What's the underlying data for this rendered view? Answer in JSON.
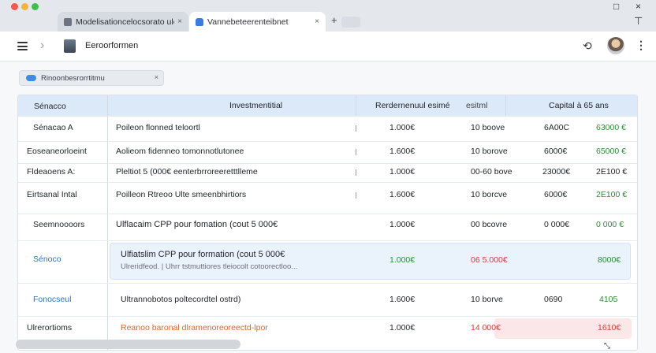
{
  "tabs": [
    {
      "title": "Modelisationcelocsorato ule",
      "close": "×"
    },
    {
      "title": "Vannebeteerenteibnet",
      "close": "×"
    }
  ],
  "new_tab_symbol": "+",
  "window_controls": {
    "maximize": "□",
    "close": "×",
    "pin": "⊤"
  },
  "toolbar": {
    "title": "Eeroorformen"
  },
  "filter_chip": {
    "label": "Rinoonbesrorrtitmu",
    "close": "×"
  },
  "table": {
    "headers": {
      "scenario": "Sénacco",
      "investment": "Investmentitial",
      "yield": "Rerdernenuul esimé",
      "yield_suffix": "esitml",
      "capital": "Capital à 65 ans"
    },
    "rows": [
      {
        "scenario": "Sénacao A",
        "investment": "Poileon flonned teloortl",
        "amount": "1.000€",
        "yield": "10 boove",
        "capital1": "6A00C",
        "capital2": "63000 €"
      },
      {
        "scenario": "Eoseaneorloeint",
        "investment": "Aolieom fidenneo tomonnotlutonee",
        "amount": "1.600€",
        "yield": "10 borove",
        "capital1": "6000€",
        "capital2": "65000 €"
      },
      {
        "scenario": "Fldeaoens A:",
        "investment": "Pleltiot 5 (000€ eenterbrroreeretttlleme",
        "amount": "1.000€",
        "yield": "00-60 bove",
        "capital1": "23000€",
        "capital2": "2E100 €"
      },
      {
        "scenario": "Eirtsanal Intal",
        "investment": "Poilleon Rtreoo  Ulte smeenbhirtiors",
        "amount": "1.600€",
        "yield": "10 borcve",
        "capital1": "6000€",
        "capital2": "2E100 €"
      },
      {
        "scenario": "Seemnoooors",
        "investment": "Ulflacaim CPP pour fomation (cout 5 000€",
        "amount": "1.000€",
        "yield": "00 bcovre",
        "capital1": "0 000€",
        "capital2": "0 000 €"
      },
      {
        "scenario": "Sénoco",
        "investment": "Ulfiatslim CPP  pour  formation (cout 5 000€",
        "investment_sub": "Ulreridfeod. | Uhrr tstmuttiores tleiocolt cotoorectloo...",
        "amount": "1.000€",
        "yield": "06 5.000€",
        "capital2": "8000€"
      },
      {
        "scenario": "Fonocseul",
        "investment": "Ultrannobotos poltecordtel ostrd)",
        "amount": "1.600€",
        "yield": "10 borve",
        "capital1": "0690",
        "capital2": "4105"
      },
      {
        "scenario": "Ulrerortioms",
        "investment": "Reanoo baronal  dlramenoreoreectd-lpor",
        "amount": "1.000€",
        "yield": "14 000€",
        "capital2": "1610€"
      }
    ]
  },
  "corner_icon": "⤡",
  "colors": {
    "header_bg": "#dbe9f8",
    "green": "#2f8a3a",
    "red": "#c6423b",
    "blue": "#2a74c9",
    "orange": "#d9662e"
  }
}
